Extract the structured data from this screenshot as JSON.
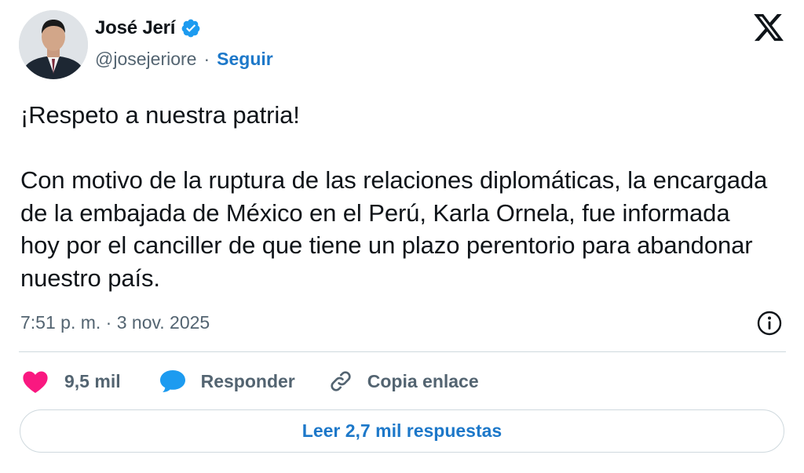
{
  "author": {
    "name": "José Jerí",
    "handle": "@josejeriore",
    "separator": "·",
    "follow_label": "Seguir",
    "verified": true,
    "verified_color": "#1d9bf0"
  },
  "tweet": {
    "paragraphs": [
      "¡Respeto a nuestra patria!",
      "Con motivo de la ruptura de las relaciones diplomáticas, la encargada de la embajada de México en el Perú, Karla Ornela, fue informada hoy por el canciller de que tiene un plazo perentorio para abandonar nuestro país."
    ],
    "timestamp": "7:51 p. m. · 3 nov. 2025"
  },
  "actions": {
    "like_count": "9,5 mil",
    "reply_label": "Responder",
    "copy_label": "Copia enlace"
  },
  "read_replies_label": "Leer 2,7 mil respuestas",
  "colors": {
    "like": "#f91880",
    "reply": "#1d9bf0",
    "link": "#1d78c9",
    "muted": "#536471"
  },
  "icons": [
    "verified-badge-icon",
    "x-logo-icon",
    "info-icon",
    "heart-icon",
    "reply-bubble-icon",
    "link-icon"
  ]
}
